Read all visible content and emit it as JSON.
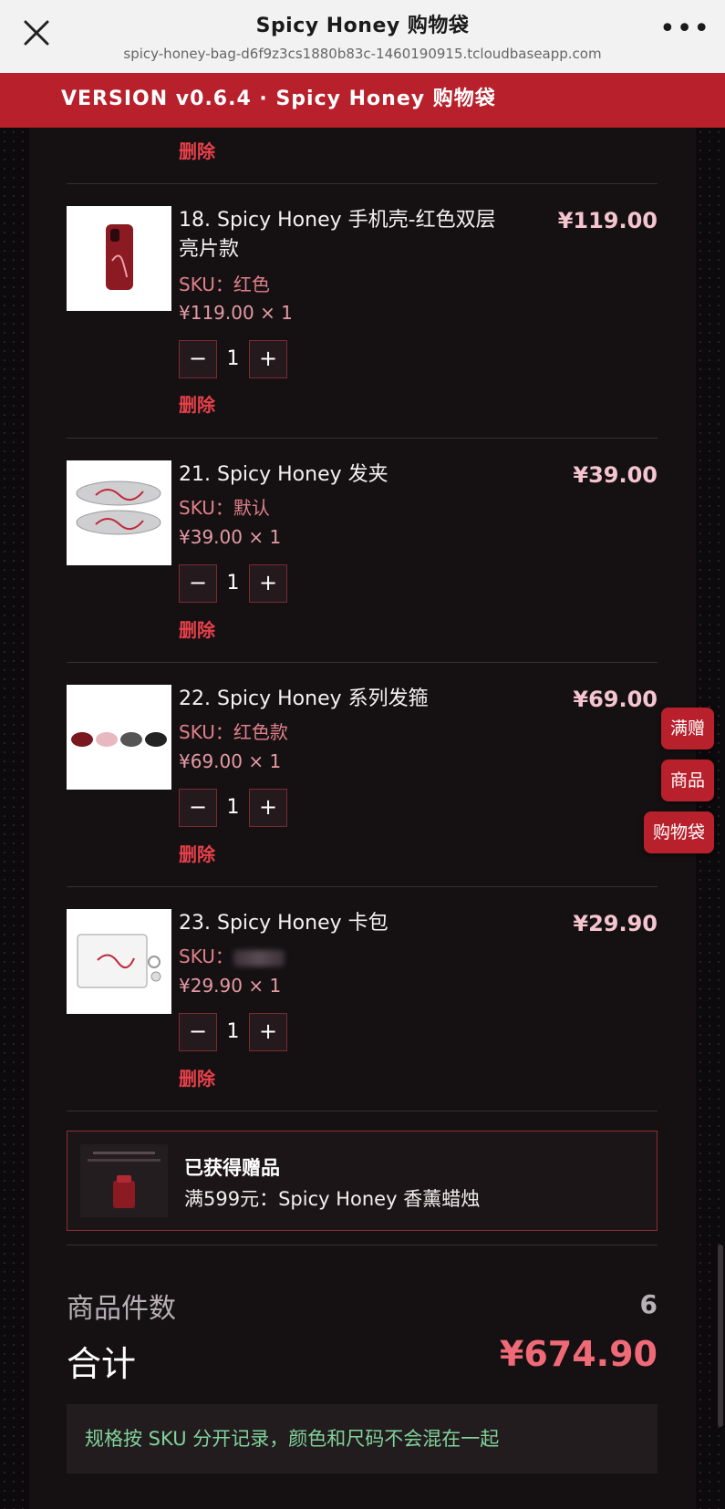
{
  "topbar": {
    "title": "Spicy Honey 购物袋",
    "url": "spicy-honey-bag-d6f9z3cs1880b83c-1460190915.tcloudbaseapp.com",
    "more": "•••"
  },
  "banner": {
    "text": "VERSION v0.6.4 · Spicy Honey 购物袋"
  },
  "prev_delete": "删除",
  "items": [
    {
      "name": "18. Spicy Honey 手机壳-红色双层亮片款",
      "price": "¥119.00",
      "sku": "SKU：红色",
      "unit": "¥119.00 × 1",
      "qty": "1",
      "minus": "−",
      "plus": "+",
      "delete": "删除"
    },
    {
      "name": "21. Spicy Honey 发夹",
      "price": "¥39.00",
      "sku": "SKU：默认",
      "unit": "¥39.00 × 1",
      "qty": "1",
      "minus": "−",
      "plus": "+",
      "delete": "删除"
    },
    {
      "name": "22. Spicy Honey 系列发箍",
      "price": "¥69.00",
      "sku": "SKU：红色款",
      "unit": "¥69.00 × 1",
      "qty": "1",
      "minus": "−",
      "plus": "+",
      "delete": "删除"
    },
    {
      "name": "23. Spicy Honey 卡包",
      "price": "¥29.90",
      "sku": "SKU：",
      "unit": "¥29.90 × 1",
      "qty": "1",
      "minus": "−",
      "plus": "+",
      "delete": "删除"
    }
  ],
  "float_nav": [
    "满赠",
    "商品",
    "购物袋"
  ],
  "gift": {
    "title": "已获得赠品",
    "desc": "满599元：Spicy Honey 香薰蜡烛"
  },
  "summary": {
    "count_label": "商品件数",
    "count_value": "6",
    "total_label": "合计",
    "total_value": "¥674.90"
  },
  "note": "规格按 SKU 分开记录，颜色和尺码不会混在一起",
  "colors": {
    "brand_red": "#b8202b",
    "delete_red": "#e8404a",
    "total_pink": "#ef6a76",
    "note_green": "#7fd39a"
  }
}
